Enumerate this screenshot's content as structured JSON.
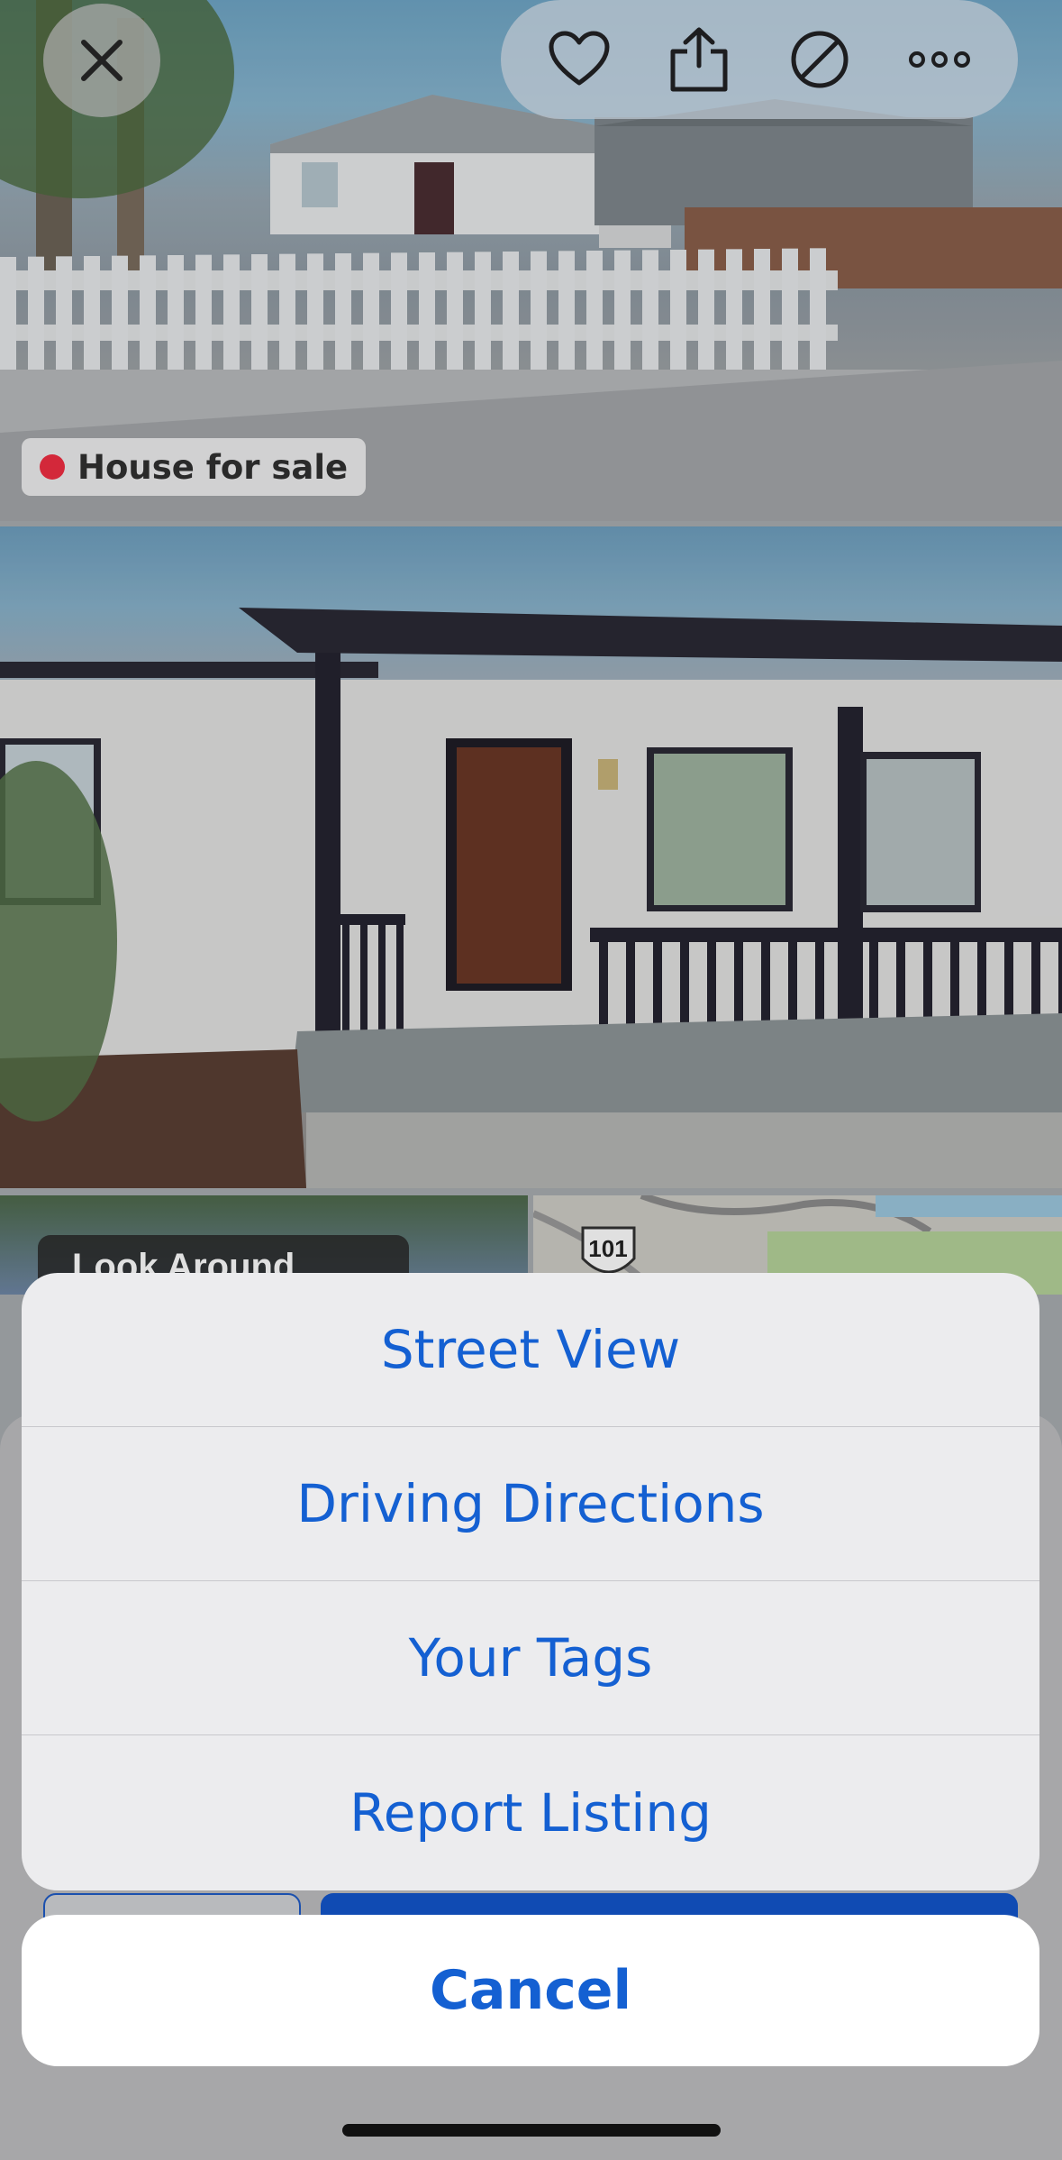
{
  "listing": {
    "badge_label": "House for sale",
    "look_around_label": "Look Around",
    "map_route_label": "101"
  },
  "toolbar": {
    "close_icon": "close-icon",
    "favorite_icon": "heart-icon",
    "share_icon": "share-icon",
    "hide_icon": "prohibited-icon",
    "more_icon": "more-icon"
  },
  "action_sheet": {
    "items": [
      {
        "label": "Street View"
      },
      {
        "label": "Driving Directions"
      },
      {
        "label": "Your Tags"
      },
      {
        "label": "Report Listing"
      }
    ],
    "cancel_label": "Cancel"
  },
  "colors": {
    "accent": "#1460d2",
    "badge_dot": "#d3283a",
    "sheet_bg": "#ececee"
  }
}
